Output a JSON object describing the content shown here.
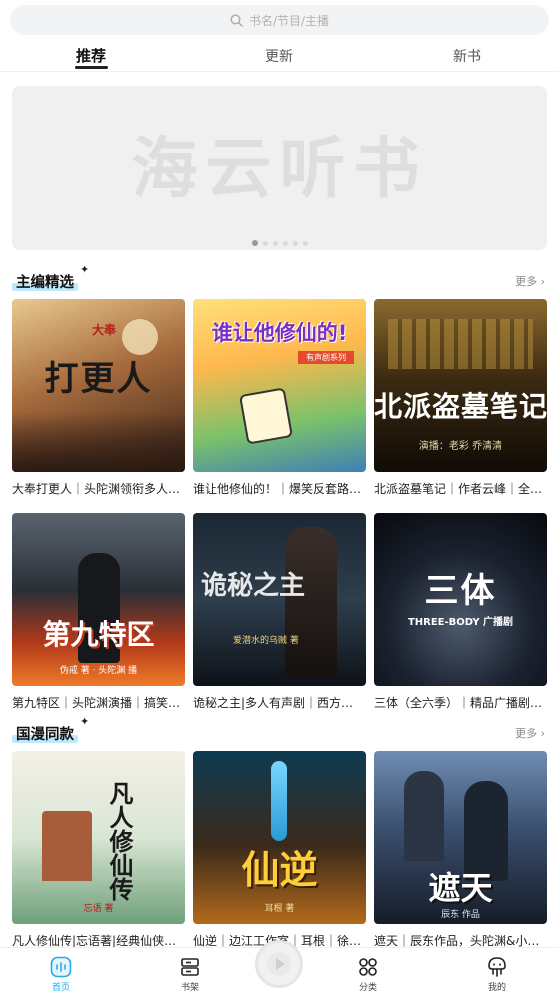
{
  "search": {
    "placeholder": "书名/节目/主播"
  },
  "tabs": [
    {
      "label": "推荐",
      "active": true
    },
    {
      "label": "更新",
      "active": false
    },
    {
      "label": "新书",
      "active": false
    }
  ],
  "banner": {
    "text": "海云听书",
    "page_count": 6,
    "current_page": 1
  },
  "sections": [
    {
      "title": "主编精选",
      "more": "更多 ›",
      "items": [
        {
          "caption": "大奉打更人｜头陀渊领衔多人…",
          "cover_title": "打更人",
          "cover_sub": "大奉"
        },
        {
          "caption": "谁让他修仙的！｜爆笑反套路…",
          "cover_title": "谁让他修仙的!",
          "cover_sub": "有声剧系列"
        },
        {
          "caption": "北派盗墓笔记｜作者云峰｜全…",
          "cover_title": "北派盗墓笔记",
          "cover_sub": "演播：老彩 乔清清"
        },
        {
          "caption": "第九特区｜头陀渊演播｜搞笑…",
          "cover_title": "第九特区",
          "cover_sub": "伪戒 著 · 头陀渊 播"
        },
        {
          "caption": "诡秘之主|多人有声剧｜西方…",
          "cover_title": "诡秘之主",
          "cover_sub": "爱潜水的乌贼 著"
        },
        {
          "caption": "三体（全六季）｜精品广播剧…",
          "cover_title": "三体",
          "cover_sub": "THREE-BODY 广播剧"
        }
      ]
    },
    {
      "title": "国漫同款",
      "more": "更多 ›",
      "items": [
        {
          "caption": "凡人修仙传|忘语著|经典仙侠…",
          "cover_title": "凡人修仙传",
          "cover_sub": "忘语 著"
        },
        {
          "caption": "仙逆｜边江工作室｜耳根｜徐…",
          "cover_title": "仙逆",
          "cover_sub": "耳根 著"
        },
        {
          "caption": "遮天｜辰东作品，头陀渊&小…",
          "cover_title": "遮天",
          "cover_sub": "辰东 作品"
        }
      ]
    }
  ],
  "bottom_nav": [
    {
      "label": "首页",
      "icon": "home-wave-icon",
      "active": true
    },
    {
      "label": "书架",
      "icon": "bookshelf-icon",
      "active": false
    },
    {
      "label": "",
      "icon": "play-disc-icon",
      "active": false
    },
    {
      "label": "分类",
      "icon": "category-grid-icon",
      "active": false
    },
    {
      "label": "我的",
      "icon": "profile-icon",
      "active": false
    }
  ],
  "colors": {
    "accent": "#2aa8e8",
    "section_highlight": "#bfe9fb",
    "banner_bg": "#f0f0f0"
  }
}
